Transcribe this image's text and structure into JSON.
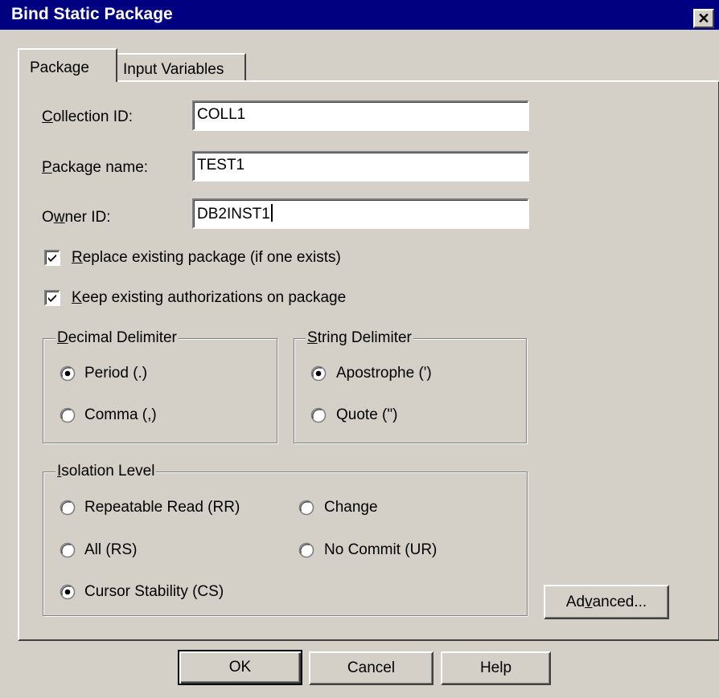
{
  "window": {
    "title": "Bind Static Package",
    "close_glyph": "✕"
  },
  "tabs": [
    {
      "label": "Package",
      "selected": true
    },
    {
      "label": "Input Variables",
      "selected": false
    }
  ],
  "package": {
    "collection_id": {
      "label_mn": "C",
      "label_rest": "ollection ID:",
      "value": "COLL1"
    },
    "package_name": {
      "label_mn": "P",
      "label_rest": "ackage name:",
      "value": "TEST1"
    },
    "owner_id": {
      "label_pre": "O",
      "label_mn": "w",
      "label_rest": "ner ID:",
      "value": "DB2INST1"
    }
  },
  "options": {
    "replace": {
      "label_mn": "R",
      "label_rest": "eplace existing package (if one exists)",
      "checked": true
    },
    "keep_auth": {
      "label_mn": "K",
      "label_rest": "eep existing authorizations on package",
      "checked": true
    }
  },
  "decimal_delimiter": {
    "legend_mn": "D",
    "legend_rest": "ecimal Delimiter",
    "options": [
      {
        "label": "Period (.)",
        "selected": true
      },
      {
        "label": "Comma (,)",
        "selected": false
      }
    ]
  },
  "string_delimiter": {
    "legend_mn": "S",
    "legend_rest": "tring Delimiter",
    "options": [
      {
        "label": "Apostrophe (')",
        "selected": true
      },
      {
        "label": "Quote (\")",
        "selected": false
      }
    ]
  },
  "isolation_level": {
    "legend_mn": "I",
    "legend_rest": "solation Level",
    "options": [
      {
        "label": "Repeatable Read (RR)",
        "selected": false
      },
      {
        "label": "Change",
        "selected": false
      },
      {
        "label": "All (RS)",
        "selected": false
      },
      {
        "label": "No Commit (UR)",
        "selected": false
      },
      {
        "label": "Cursor Stability (CS)",
        "selected": true
      }
    ]
  },
  "buttons": {
    "advanced": {
      "pre": "Ad",
      "mn": "v",
      "rest": "anced..."
    },
    "ok": "OK",
    "cancel": "Cancel",
    "help": "Help"
  },
  "colors": {
    "face": "#d4d0c8",
    "titlebar": "#000080"
  }
}
